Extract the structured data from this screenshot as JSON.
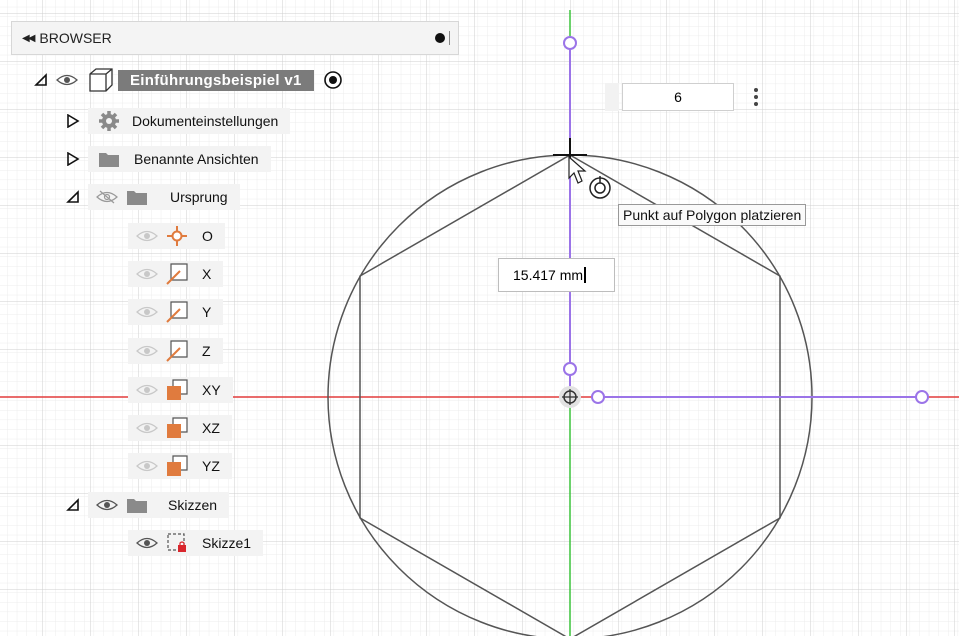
{
  "browser": {
    "title": "BROWSER",
    "root": {
      "label": "Einführungsbeispiel v1"
    },
    "items": [
      {
        "label": "Dokumenteinstellungen",
        "icon": "gear-icon"
      },
      {
        "label": "Benannte Ansichten",
        "icon": "folder-icon"
      },
      {
        "label": "Ursprung",
        "icon": "folder-icon"
      },
      {
        "label": "O",
        "icon": "origin-point-icon"
      },
      {
        "label": "X",
        "icon": "axis-icon"
      },
      {
        "label": "Y",
        "icon": "axis-icon"
      },
      {
        "label": "Z",
        "icon": "axis-icon"
      },
      {
        "label": "XY",
        "icon": "plane-icon"
      },
      {
        "label": "XZ",
        "icon": "plane-icon"
      },
      {
        "label": "YZ",
        "icon": "plane-icon"
      },
      {
        "label": "Skizzen",
        "icon": "folder-icon"
      },
      {
        "label": "Skizze1",
        "icon": "sketch-icon"
      }
    ]
  },
  "polygon": {
    "sides_value": "6"
  },
  "tooltip": {
    "text": "Punkt auf Polygon platzieren"
  },
  "dimension": {
    "value": "15.417 mm"
  },
  "colors": {
    "sketch_line": "#555555",
    "constraint": "#9b74e8",
    "x_axis": "#e23b3b",
    "y_axis": "#3cc43c",
    "grid": "#d9d9d9",
    "plane": "#e07b3e"
  }
}
